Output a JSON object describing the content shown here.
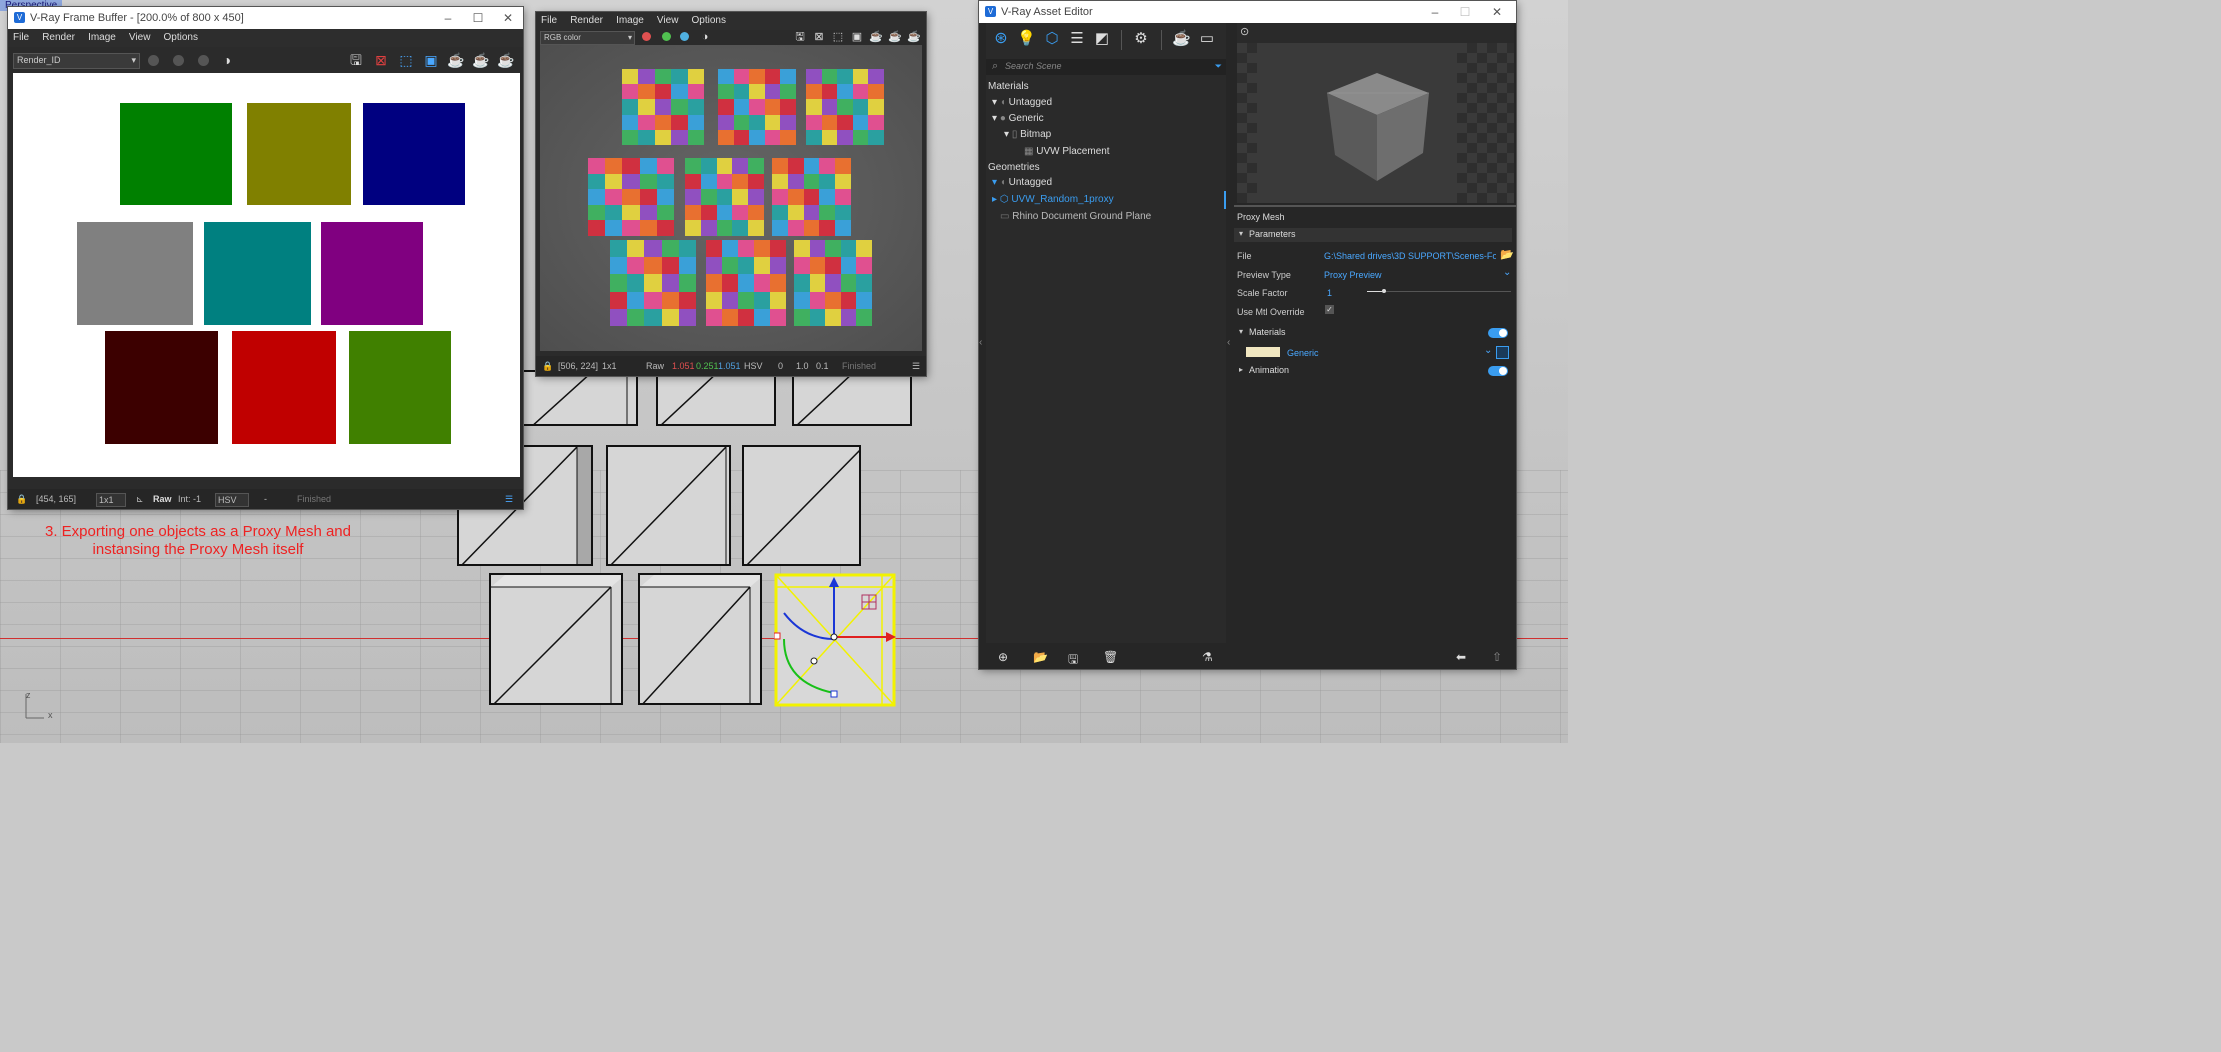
{
  "viewport": {
    "label": "Perspective",
    "axis_z": "z",
    "axis_x": "x",
    "annotation_line1": "3. Exporting one objects as a Proxy Mesh and",
    "annotation_line2": "instansing the Proxy Mesh itself"
  },
  "vfb1": {
    "title": "V-Ray Frame Buffer - [200.0% of 800 x 450]",
    "menu": [
      "File",
      "Render",
      "Image",
      "View",
      "Options"
    ],
    "channel": "Render_ID",
    "status": {
      "coords": "[454, 165]",
      "scale": "1x1",
      "mode": "Raw",
      "int": "Int: -1",
      "colorspace": "HSV",
      "dash": "-",
      "state": "Finished"
    },
    "swatch_colors": [
      "#008000",
      "#808000",
      "#000080",
      "#808080",
      "#008080",
      "#800080",
      "#3c0000",
      "#c00000",
      "#408000"
    ]
  },
  "vfb2": {
    "menu": [
      "File",
      "Render",
      "Image",
      "View",
      "Options"
    ],
    "channel": "RGB color",
    "status": {
      "coords": "[506, 224]",
      "scale": "1x1",
      "mode": "Raw",
      "r": "1.051",
      "g": "0.251",
      "b": "1.051",
      "colorspace": "HSV",
      "v0": "0",
      "v1": "1.0",
      "v2": "0.1",
      "state": "Finished"
    }
  },
  "asset_editor": {
    "title": "V-Ray Asset Editor",
    "search_placeholder": "Search Scene",
    "tree": {
      "materials_header": "Materials",
      "untagged1": "Untagged",
      "generic": "Generic",
      "bitmap": "Bitmap",
      "uvw_placement": "UVW Placement",
      "geometries_header": "Geometries",
      "untagged2": "Untagged",
      "proxy": "UVW_Random_1proxy",
      "ground": "Rhino Document Ground Plane"
    },
    "props": {
      "section": "Proxy Mesh",
      "parameters": "Parameters",
      "file_label": "File",
      "file_value": "G:\\Shared drives\\3D SUPPORT\\Scenes-Foru...",
      "preview_label": "Preview Type",
      "preview_value": "Proxy Preview",
      "scale_label": "Scale Factor",
      "scale_value": "1",
      "override_label": "Use Mtl Override",
      "materials": "Materials",
      "material_item": "Generic",
      "material_swatch": "#f0e6c0",
      "animation": "Animation"
    }
  }
}
